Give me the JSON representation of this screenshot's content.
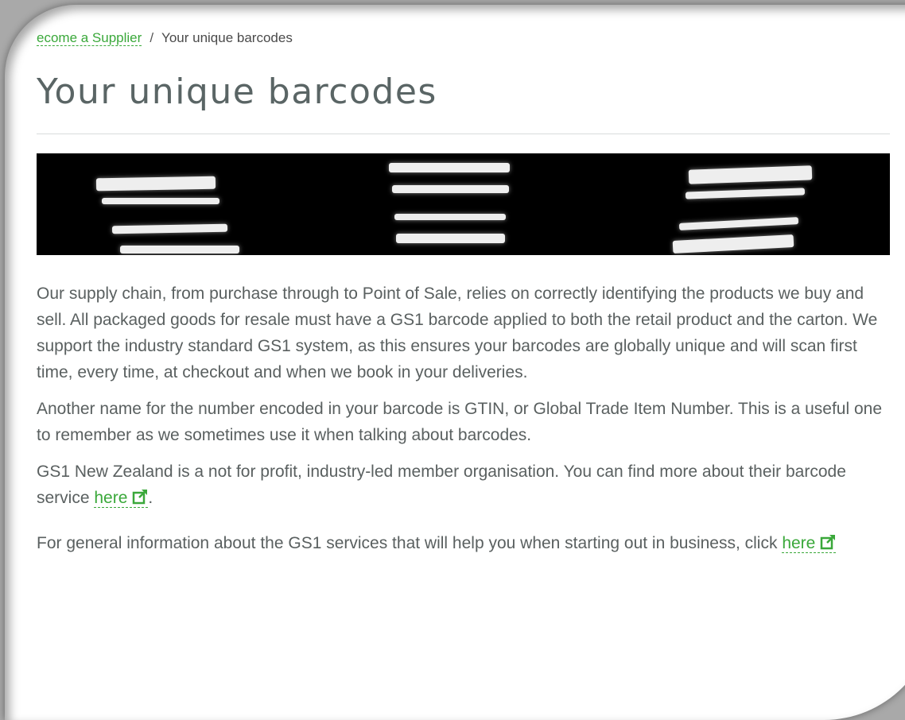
{
  "breadcrumb": {
    "parent_label": "ecome a Supplier",
    "separator": "/",
    "current_label": "Your unique barcodes"
  },
  "page_title": "Your unique barcodes",
  "banner": {
    "icon": "barcode-closeup-image"
  },
  "paragraphs": {
    "p1": "Our supply chain, from purchase through to Point of Sale, relies on correctly identifying the products we buy and sell. All packaged goods for resale must have a GS1 barcode applied to both the retail product and the carton. We support the industry standard GS1 system, as this ensures your barcodes are globally unique and will scan first time, every time, at checkout and when we book in your deliveries.",
    "p2": "Another name for the number encoded in your barcode is GTIN, or Global Trade Item Number. This is a useful one to remember as we sometimes use it when talking about barcodes.",
    "p3_before": "GS1 New Zealand is a not for profit, industry-led member organisation. You can find more about their barcode service ",
    "p3_link": "here",
    "p3_after": ".",
    "p4_before": "For general information about the GS1 services that will help you when starting out in business, click ",
    "p4_link": "here"
  },
  "colors": {
    "link": "#3aa83a",
    "text": "#5a6060",
    "title": "#5a6565"
  },
  "icons": {
    "external_link": "external-link-icon"
  }
}
